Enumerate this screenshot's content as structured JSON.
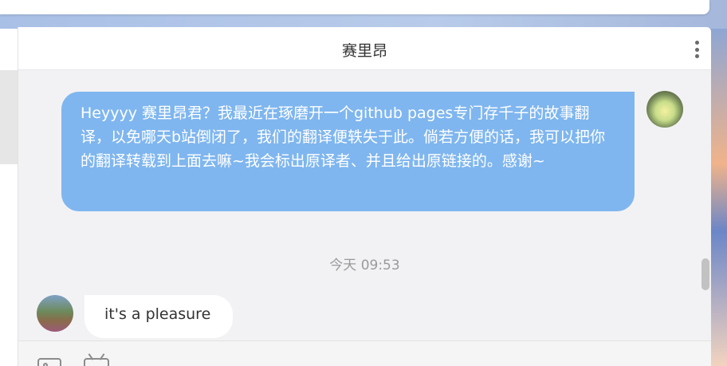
{
  "header": {
    "title": "赛里昂"
  },
  "messages": [
    {
      "side": "right",
      "text": "Heyyyy 赛里昂君？我最近在琢磨开一个github pages专门存千子的故事翻译，以免哪天b站倒闭了，我们的翻译便轶失于此。倘若方便的话，我可以把你的翻译转载到上面去嘛~我会标出原译者、并且给出原链接的。感谢~"
    },
    {
      "timestamp": "今天 09:53"
    },
    {
      "side": "left",
      "text": "it's a pleasure"
    }
  ],
  "icons": {
    "more": "more-vertical-icon",
    "image": "image-icon",
    "tv": "tv-icon"
  },
  "colors": {
    "my_bubble": "#7fb6ef",
    "their_bubble": "#ffffff",
    "chat_bg": "#f2f2f4"
  }
}
